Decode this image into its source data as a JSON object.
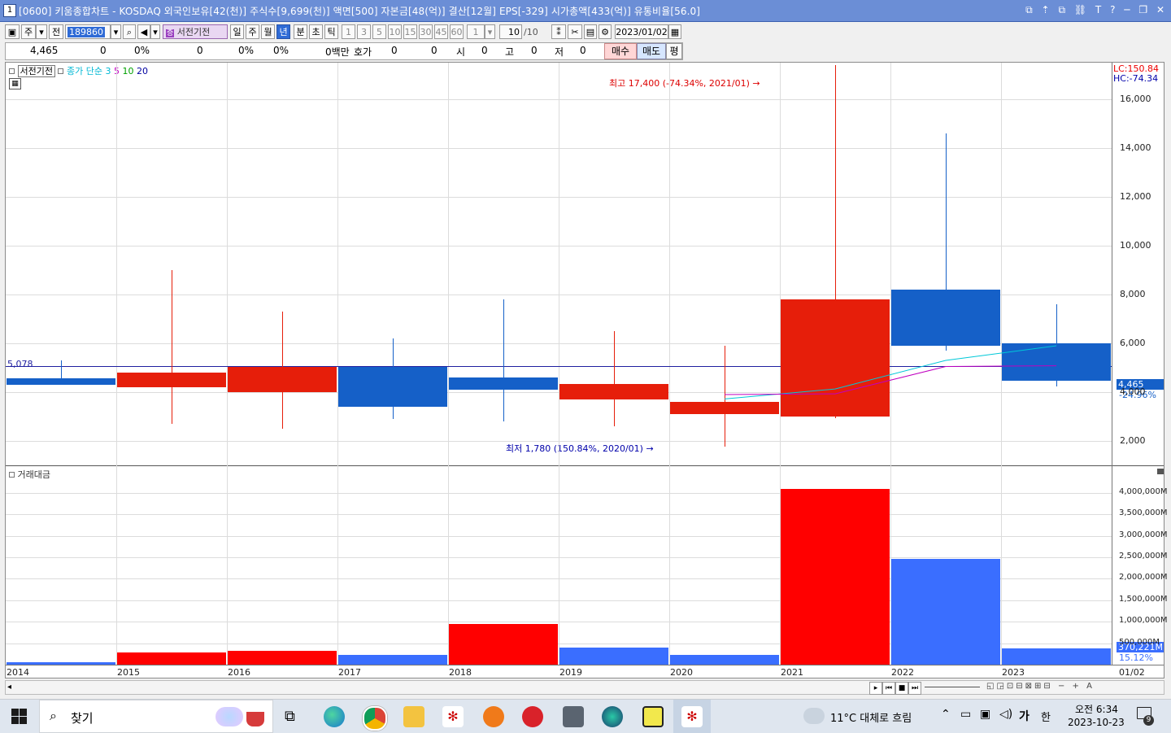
{
  "titlebar": {
    "window_num": "1",
    "title": "[0600] 키움종합차트 - KOSDAQ 외국인보유[42(천)] 주식수[9,699(천)] 액면[500] 자본금[48(억)] 결산[12월] EPS[-329] 시가총액[433(억)] 유통비율[56.0]",
    "controls": [
      "⧉",
      "⇡",
      "⧉",
      "⛓",
      "T",
      "?",
      "─",
      "❐",
      "✕"
    ]
  },
  "toolbar": {
    "type_label": "주",
    "prev_label": "전",
    "code_value": "189860",
    "chart_name": "서전기전",
    "periods": [
      "일",
      "주",
      "월",
      "년",
      "분",
      "초",
      "틱"
    ],
    "selected_period": "년",
    "intervals": [
      "1",
      "3",
      "5",
      "10",
      "15",
      "30",
      "45",
      "60"
    ],
    "custom_interval": "1",
    "count_value": "10",
    "count_total": "/10",
    "date_value": "2023/01/02"
  },
  "quote": {
    "price": "4,465",
    "change": "0",
    "change_pct": "0%",
    "volume": "0",
    "vol_pct": "0%",
    "vol_pct2": "0%",
    "amount": "0백만",
    "hoga_label": "호가",
    "hoga_1": "0",
    "hoga_2": "0",
    "open_label": "시",
    "open": "0",
    "high_label": "고",
    "high": "0",
    "low_label": "저",
    "low": "0",
    "buy_label": "매수",
    "sell_label": "매도",
    "avg_label": "평"
  },
  "chart_header": {
    "stock_name": "서전기전",
    "ma_label": "종가 단순",
    "ma_periods": [
      "3",
      "5",
      "10",
      "20"
    ],
    "ma_colors": [
      "#00b8d4",
      "#c000c0",
      "#00a000",
      "#0000a0"
    ],
    "lc_label": "LC:150.84",
    "hc_label": "HC:-74.34",
    "high_note": "최고 17,400 (-74.34%, 2021/01)",
    "low_note": "최저 1,780 (150.84%, 2020/01)",
    "ref_line_label": "5,078",
    "current_price_tag": "4,465",
    "current_pct_tag": "-24.96%",
    "volume_panel_label": "거래대금",
    "volume_last_tag": "370,221M",
    "volume_pct_tag": "15.12%"
  },
  "colors": {
    "up": "#e61e0a",
    "down": "#1560c8",
    "vol_up": "#ff0000",
    "vol_down": "#3a6eff",
    "ref_line": "#1f1fa0",
    "ma3": "#00c8d8",
    "ma5": "#c000c0"
  },
  "chart_data": [
    {
      "type": "candlestick",
      "title": "",
      "x": [
        "2014",
        "2015",
        "2016",
        "2017",
        "2018",
        "2019",
        "2020",
        "2021",
        "2022",
        "2023"
      ],
      "open": [
        4560,
        4200,
        4000,
        5050,
        4600,
        3700,
        3100,
        3000,
        8200,
        6000
      ],
      "high": [
        5300,
        9000,
        7300,
        6200,
        7800,
        6500,
        5900,
        17400,
        14600,
        7600
      ],
      "low": [
        4300,
        2700,
        2500,
        2900,
        2800,
        2600,
        1780,
        2950,
        5700,
        4250
      ],
      "close": [
        4300,
        4800,
        5050,
        3400,
        4100,
        4350,
        3600,
        7800,
        5900,
        4465
      ],
      "ma3": [
        null,
        null,
        null,
        null,
        null,
        null,
        3720,
        4130,
        5300,
        5900
      ],
      "ma5": [
        null,
        null,
        null,
        null,
        null,
        null,
        3900,
        3930,
        5050,
        5080
      ],
      "ylim": [
        1000,
        17500
      ],
      "yticks": [
        2000,
        4000,
        6000,
        8000,
        10000,
        12000,
        14000,
        16000
      ],
      "ytick_labels": [
        "2,000",
        "4,000",
        "6,000",
        "8,000",
        "10,000",
        "12,000",
        "14,000",
        "16,000"
      ],
      "ref_value": 5078
    },
    {
      "type": "bar",
      "title": "거래대금",
      "x": [
        "2014",
        "2015",
        "2016",
        "2017",
        "2018",
        "2019",
        "2020",
        "2021",
        "2022",
        "2023"
      ],
      "values": [
        60,
        290,
        320,
        230,
        950,
        400,
        230,
        4100,
        2460,
        370
      ],
      "direction": [
        "down",
        "up",
        "up",
        "down",
        "up",
        "down",
        "down",
        "up",
        "down",
        "down"
      ],
      "unit": "M",
      "ylim": [
        0,
        4300
      ],
      "yticks": [
        500,
        1000,
        1500,
        2000,
        2500,
        3000,
        3500,
        4000
      ],
      "ytick_labels": [
        "500,000M",
        "1,000,000M",
        "1,500,000M",
        "2,000,000M",
        "2,500,000M",
        "3,000,000M",
        "3,500,000M",
        "4,000,000M"
      ]
    }
  ],
  "xaxis_last_label": "01/02",
  "taskbar": {
    "search_label": "찾기",
    "weather": "11°C 대체로 흐림",
    "ime_1": "가",
    "ime_2": "한",
    "time": "오전 6:34",
    "date": "2023-10-23",
    "notif_count": "9"
  }
}
